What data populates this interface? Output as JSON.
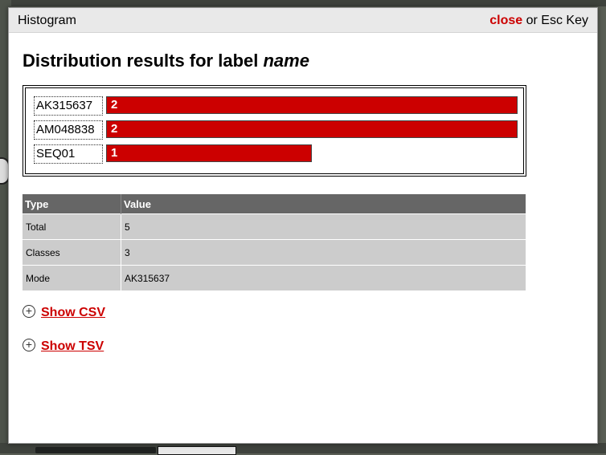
{
  "dialog": {
    "title": "Histogram",
    "close_link": "close",
    "close_hint": " or Esc Key"
  },
  "heading": {
    "prefix": "Distribution results for label ",
    "label_name": "name"
  },
  "chart_data": {
    "type": "bar",
    "orientation": "horizontal",
    "categories": [
      "AK315637",
      "AM048838",
      "SEQ01"
    ],
    "values": [
      2,
      2,
      1
    ],
    "xlim": [
      0,
      2
    ],
    "bar_color": "#cc0000"
  },
  "stats_table": {
    "headers": [
      "Type",
      "Value"
    ],
    "rows": [
      {
        "type": "Total",
        "value": "5"
      },
      {
        "type": "Classes",
        "value": "3"
      },
      {
        "type": "Mode",
        "value": "AK315637"
      }
    ]
  },
  "toggles": {
    "csv": {
      "icon": "plus-circle-icon",
      "label": "Show CSV"
    },
    "tsv": {
      "icon": "plus-circle-icon",
      "label": "Show TSV"
    }
  },
  "colors": {
    "accent": "#cc0000",
    "header_bg": "#666666",
    "cell_bg": "#cccccc"
  }
}
